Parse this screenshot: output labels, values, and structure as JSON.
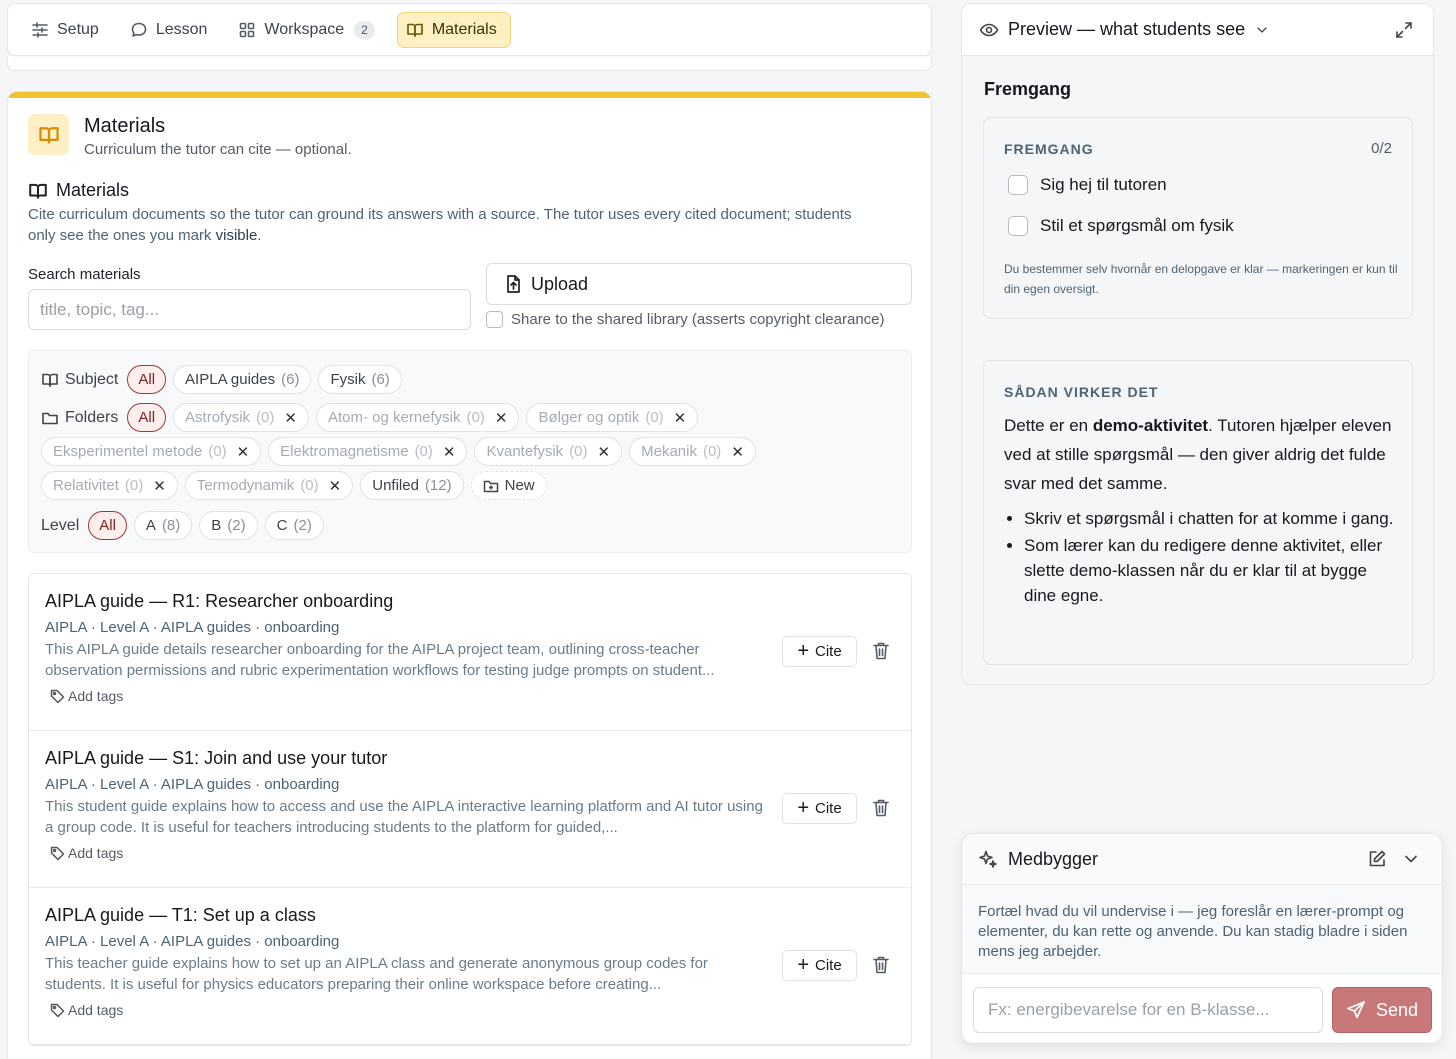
{
  "tabs": [
    {
      "label": "Setup",
      "icon": "sliders-icon"
    },
    {
      "label": "Lesson",
      "icon": "chat-bubble-icon"
    },
    {
      "label": "Workspace",
      "icon": "grid-icon",
      "badge": "2"
    },
    {
      "label": "Materials",
      "icon": "book-icon",
      "active": true
    }
  ],
  "header": {
    "title": "Materials",
    "subtitle": "Curriculum the tutor can cite — optional."
  },
  "section": {
    "title": "Materials",
    "desc_part1": "Cite curriculum documents so the tutor can ground its answers with a source. The tutor uses every cited document; students only see the ones you mark ",
    "desc_bold": "visible",
    "desc_part2": "."
  },
  "search": {
    "label": "Search materials",
    "placeholder": "title, topic, tag...",
    "value": ""
  },
  "upload": {
    "label": "Upload",
    "share_label": "Share to the shared library (asserts copyright clearance)"
  },
  "filters": {
    "subject": {
      "label": "Subject",
      "all_label": "All",
      "options": [
        {
          "name": "AIPLA guides",
          "count": "(6)"
        },
        {
          "name": "Fysik",
          "count": "(6)"
        }
      ]
    },
    "folders": {
      "label": "Folders",
      "all_label": "All",
      "options": [
        {
          "name": "Astrofysik",
          "count": "(0)"
        },
        {
          "name": "Atom- og kernefysik",
          "count": "(0)"
        },
        {
          "name": "Bølger og optik",
          "count": "(0)"
        },
        {
          "name": "Eksperimentel metode",
          "count": "(0)"
        },
        {
          "name": "Elektromagnetisme",
          "count": "(0)"
        },
        {
          "name": "Kvantefysik",
          "count": "(0)"
        },
        {
          "name": "Mekanik",
          "count": "(0)"
        },
        {
          "name": "Relativitet",
          "count": "(0)"
        },
        {
          "name": "Termodynamik",
          "count": "(0)"
        }
      ],
      "unfiled": {
        "name": "Unfiled",
        "count": "(12)"
      },
      "new_label": "New"
    },
    "level": {
      "label": "Level",
      "all_label": "All",
      "options": [
        {
          "name": "A",
          "count": "(8)"
        },
        {
          "name": "B",
          "count": "(2)"
        },
        {
          "name": "C",
          "count": "(2)"
        }
      ]
    }
  },
  "materials": [
    {
      "title": "AIPLA guide — R1: Researcher onboarding",
      "meta": "AIPLA · Level A · AIPLA guides · onboarding",
      "desc": "This AIPLA guide details researcher onboarding for the AIPLA project team, outlining cross-teacher observation permissions and rubric experimentation workflows for testing judge prompts on student...",
      "tags_label": "Add tags",
      "cite_label": "Cite"
    },
    {
      "title": "AIPLA guide — S1: Join and use your tutor",
      "meta": "AIPLA · Level A · AIPLA guides · onboarding",
      "desc": "This student guide explains how to access and use the AIPLA interactive learning platform and AI tutor using a group code. It is useful for teachers introducing students to the platform for guided,...",
      "tags_label": "Add tags",
      "cite_label": "Cite"
    },
    {
      "title": "AIPLA guide — T1: Set up a class",
      "meta": "AIPLA · Level A · AIPLA guides · onboarding",
      "desc": "This teacher guide explains how to set up an AIPLA class and generate anonymous group codes for students. It is useful for physics educators preparing their online workspace before creating...",
      "tags_label": "Add tags",
      "cite_label": "Cite"
    }
  ],
  "preview": {
    "header": "Preview — what students see",
    "section_title": "Fremgang",
    "progress": {
      "heading": "FREMGANG",
      "count": "0/2",
      "tasks": [
        "Sig hej til tutoren",
        "Stil et spørgsmål om fysik"
      ],
      "note": "Du bestemmer selv hvornår en delopgave er klar — markeringen er kun til din egen oversigt."
    },
    "how": {
      "heading": "SÅDAN VIRKER DET",
      "text_part1": "Dette er en ",
      "text_bold": "demo-aktivitet",
      "text_part2": ". Tutoren hjælper eleven ved at stille spørgsmål — den giver aldrig det fulde svar med det samme.",
      "bullets": [
        "Skriv et spørgsmål i chatten for at komme i gang.",
        "Som lærer kan du redigere denne aktivitet, eller slette demo-klassen når du er klar til at bygge dine egne."
      ]
    }
  },
  "medbygger": {
    "title": "Medbygger",
    "intro": "Fortæl hvad du vil undervise i — jeg foreslår en lærer-prompt og elementer, du kan rette og anvende. Du kan stadig bladre i siden mens jeg arbejder.",
    "placeholder": "Fx: energibevarelse for en B-klasse...",
    "send_label": "Send"
  },
  "colors": {
    "accent_yellow": "#f0c22e",
    "active_tab_bg": "#fdf1c4",
    "chip_all_border": "#9a3a37",
    "send_button": "#c9787a"
  }
}
